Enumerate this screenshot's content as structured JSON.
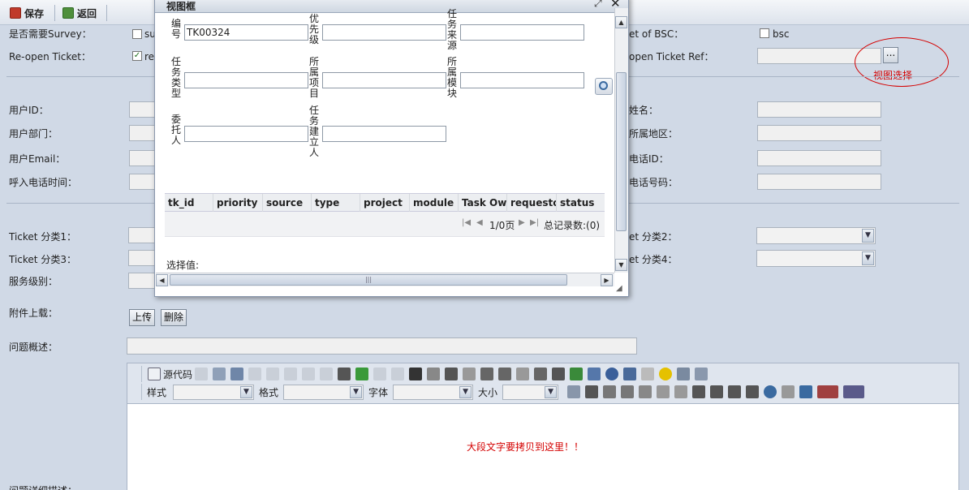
{
  "toolbar": {
    "save_label": "保存",
    "back_label": "返回"
  },
  "form": {
    "survey_label": "是否需要Survey：",
    "survey_chk_text": "su",
    "reopen_label": "Re-open Ticket：",
    "reopen_chk_text": "re",
    "bsc_label": "et of BSC：",
    "bsc_chk_text": "bsc",
    "reopen_ref_label": "open Ticket Ref：",
    "user_id_label": "用户ID：",
    "user_dept_label": "用户部门：",
    "user_email_label": "用户Email：",
    "call_time_label": "呼入电话时间：",
    "user_name_label": "姓名：",
    "user_region_label": "所属地区：",
    "phone_id_label": "电话ID：",
    "phone_no_label": "电话号码：",
    "cat1_label": "Ticket 分类1：",
    "cat3_label": "Ticket 分类3：",
    "service_label": "服务级别：",
    "cat2_label": "et 分类2：",
    "cat4_label": "et 分类4：",
    "attach_label": "附件上载：",
    "upload_btn": "上传",
    "delete_btn": "删除",
    "summary_label": "问题概述：",
    "detail_label": "问题详细描述："
  },
  "annotation": {
    "text": "视图选择",
    "color": "#d40000"
  },
  "editor": {
    "source_label": "源代码",
    "style_label": "样式",
    "format_label": "格式",
    "font_label": "字体",
    "size_label": "大小",
    "content": "大段文字要拷贝到这里！！",
    "content_color": "#d40000"
  },
  "dialog": {
    "title": "视图框",
    "labels": {
      "task_no": [
        "编",
        "号"
      ],
      "priority": [
        "优",
        "先",
        "级"
      ],
      "source": [
        "任",
        "务",
        "来",
        "源"
      ],
      "task_type": [
        "任",
        "务",
        "类",
        "型"
      ],
      "project": [
        "所",
        "属",
        "项",
        "目"
      ],
      "module": [
        "所",
        "属",
        "模",
        "块"
      ],
      "delegate": [
        "委",
        "托",
        "人"
      ],
      "creator": [
        "任",
        "务",
        "建",
        "立",
        "人"
      ]
    },
    "task_no_value": "TK00324",
    "columns": [
      "tk_id",
      "priority",
      "source",
      "type",
      "project",
      "module",
      "Task Own",
      "requestor",
      "status"
    ],
    "page_text": "1/0页",
    "total_text": "总记录数:(0)",
    "select_label": "选择值:"
  }
}
